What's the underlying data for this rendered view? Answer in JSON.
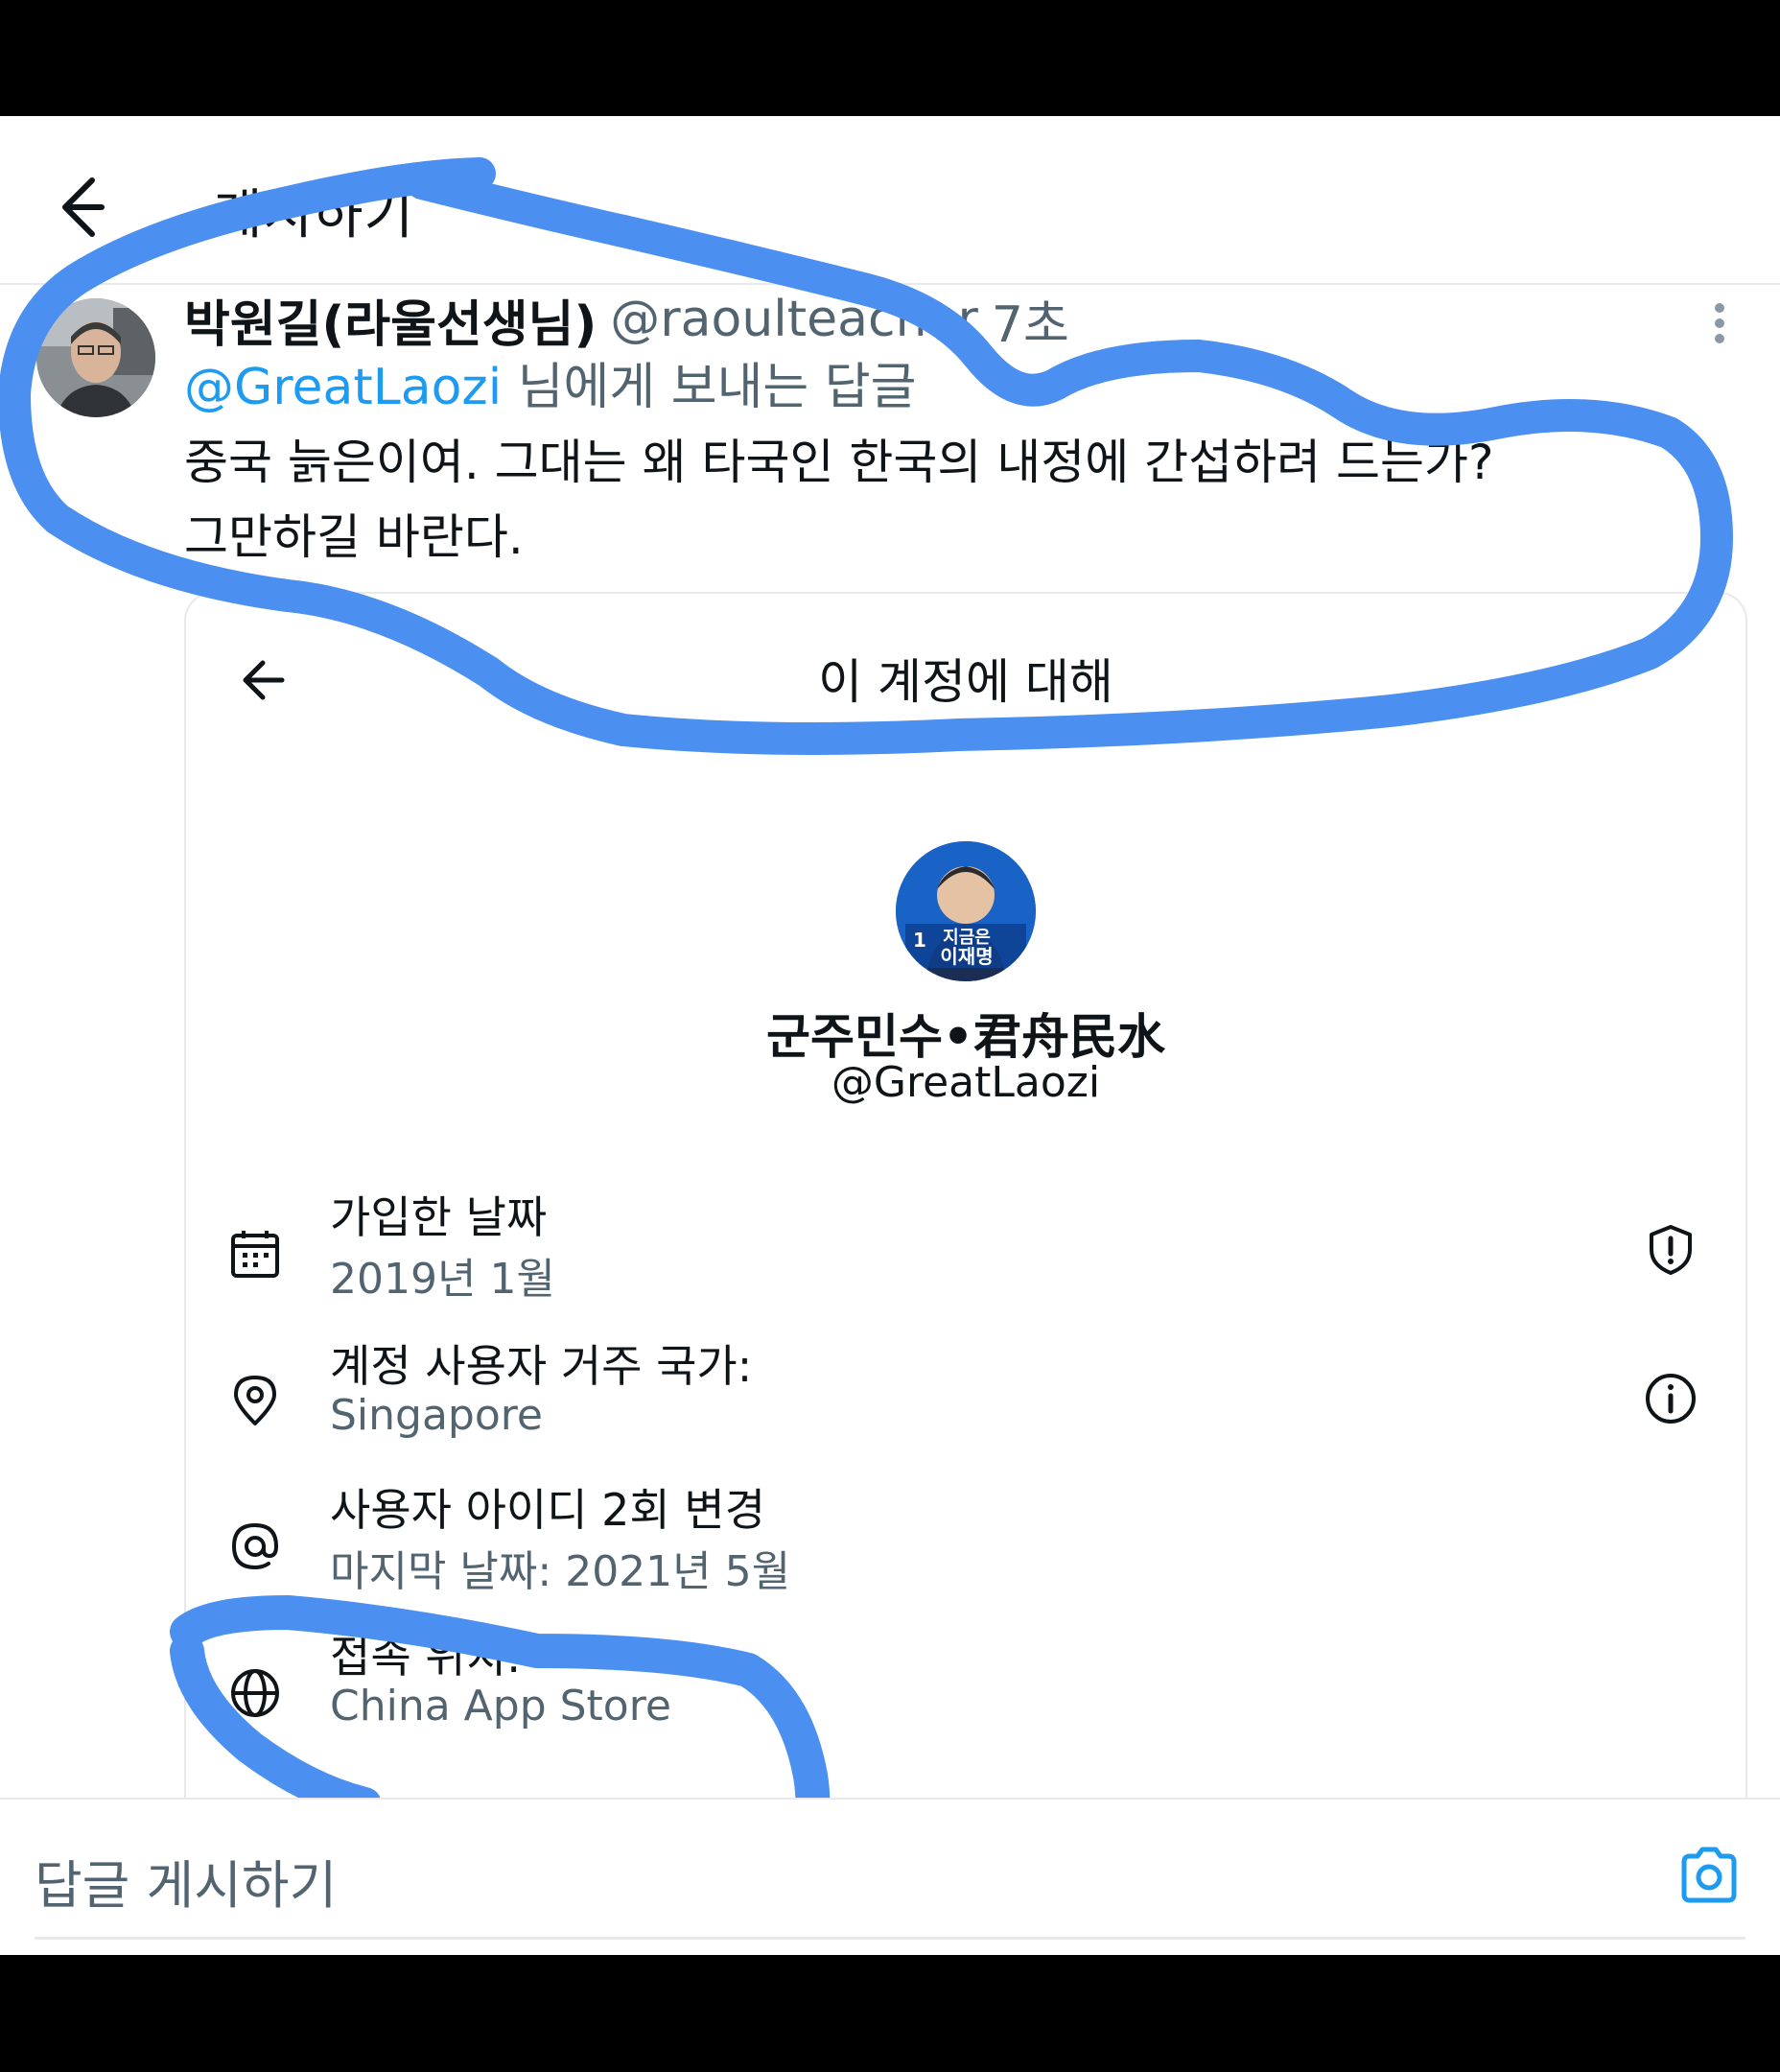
{
  "header": {
    "title": "게시하기",
    "back_icon": "arrow-left-icon"
  },
  "tweet": {
    "author_name": "박원길(라울선생님)",
    "author_handle": "@raoulteacher",
    "time": "7초",
    "reply_to_handle": "@GreatLaozi",
    "reply_to_suffix": " 님에게 보내는 답글",
    "text_line1": "중국 늙은이여. 그대는 왜 타국인 한국의 내정에 간섭하려 드는가?",
    "text_line2": "그만하길 바란다.",
    "more_icon": "more-vertical-icon"
  },
  "account_card": {
    "title": "이 계정에 대해",
    "avatar_caption_line1": "지금은",
    "avatar_caption_line2": "이재명",
    "avatar_badge": "1",
    "name": "군주민수•君舟民水",
    "handle": "@GreatLaozi",
    "rows": [
      {
        "icon": "calendar-icon",
        "label": "가입한 날짜",
        "value": "2019년 1월",
        "right_icon": "shield-alert-icon"
      },
      {
        "icon": "location-pin-icon",
        "label": "계정 사용자 거주 국가:",
        "value": "Singapore",
        "right_icon": "info-icon"
      },
      {
        "icon": "at-sign-icon",
        "label": "사용자 아이디 2회 변경",
        "value": "마지막 날짜: 2021년 5월"
      },
      {
        "icon": "globe-icon",
        "label": "접속 위치:",
        "value": "China App Store"
      }
    ]
  },
  "composer": {
    "placeholder": "답글 게시하기",
    "camera_icon": "camera-icon"
  },
  "colors": {
    "highlight_blue": "#4b8ff0",
    "link_blue": "#1d9bf0",
    "text_primary": "#0f1419",
    "text_secondary": "#536471"
  }
}
